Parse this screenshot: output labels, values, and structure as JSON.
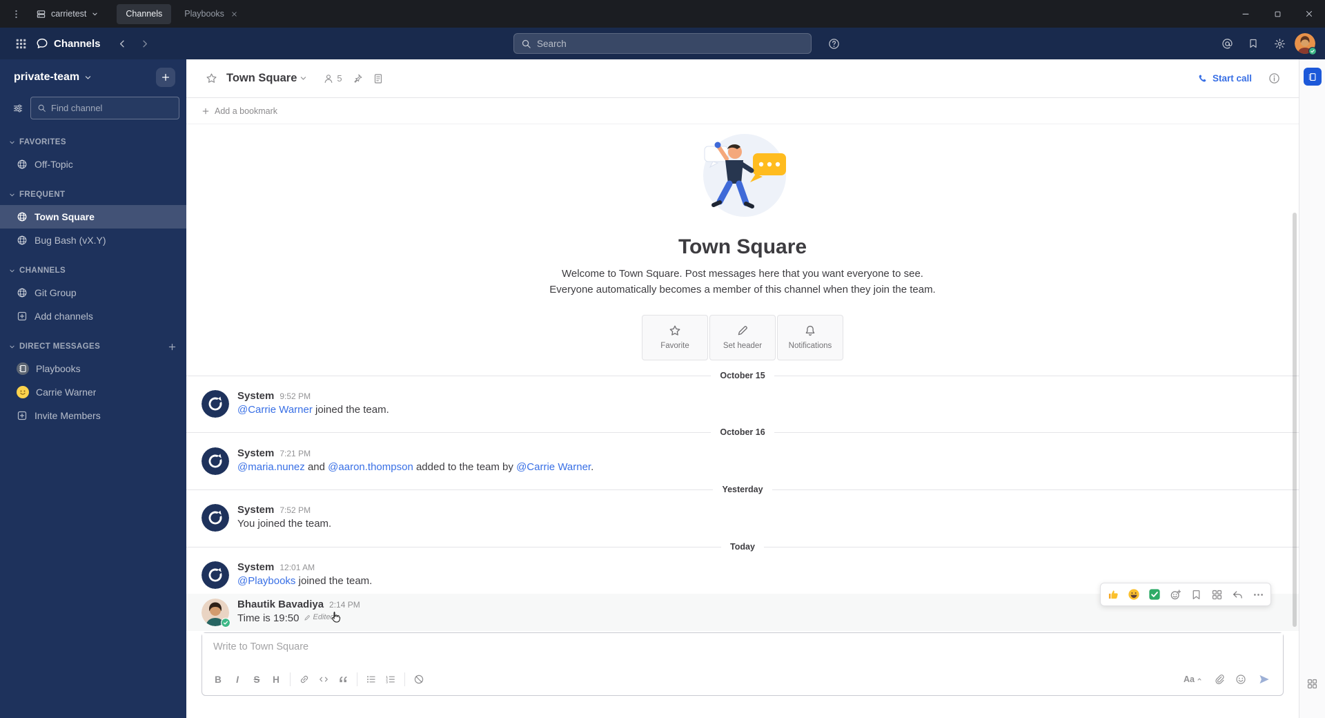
{
  "titlebar": {
    "team_selector": "carrietest",
    "tabs": [
      {
        "label": "Channels",
        "active": true,
        "closable": false
      },
      {
        "label": "Playbooks",
        "active": false,
        "closable": true
      }
    ]
  },
  "global_header": {
    "product_name": "Channels",
    "search_placeholder": "Search"
  },
  "sidebar": {
    "team_name": "private-team",
    "find_channel_placeholder": "Find channel",
    "sections": [
      {
        "label": "FAVORITES",
        "has_add": false,
        "items": [
          {
            "label": "Off-Topic",
            "icon": "globe",
            "active": false
          }
        ]
      },
      {
        "label": "FREQUENT",
        "has_add": false,
        "items": [
          {
            "label": "Town Square",
            "icon": "globe",
            "active": true
          },
          {
            "label": "Bug Bash (vX.Y)",
            "icon": "globe",
            "active": false
          }
        ]
      },
      {
        "label": "CHANNELS",
        "has_add": false,
        "items": [
          {
            "label": "Git Group",
            "icon": "globe",
            "active": false
          },
          {
            "label": "Add channels",
            "icon": "add",
            "active": false
          }
        ]
      },
      {
        "label": "DIRECT MESSAGES",
        "has_add": true,
        "items": [
          {
            "label": "Playbooks",
            "icon": "playbooks-avatar",
            "active": false
          },
          {
            "label": "Carrie Warner",
            "icon": "yellow-avatar",
            "active": false
          },
          {
            "label": "Invite Members",
            "icon": "add",
            "active": false
          }
        ]
      }
    ]
  },
  "channel_header": {
    "title": "Town Square",
    "member_count": "5",
    "start_call_label": "Start call",
    "bookmark_label": "Add a bookmark"
  },
  "intro": {
    "heading": "Town Square",
    "description": "Welcome to Town Square. Post messages here that you want everyone to see. Everyone automatically becomes a member of this channel when they join the team.",
    "actions": [
      {
        "label": "Favorite",
        "icon": "star"
      },
      {
        "label": "Set header",
        "icon": "pencil"
      },
      {
        "label": "Notifications",
        "icon": "bell"
      }
    ]
  },
  "timeline": [
    {
      "type": "divider",
      "label": "October 15"
    },
    {
      "type": "message",
      "sender": "System",
      "avatar": "system-logo",
      "time": "9:52 PM",
      "parts": [
        {
          "text": "@Carrie Warner",
          "link": true
        },
        {
          "text": " joined the team.",
          "link": false
        }
      ]
    },
    {
      "type": "divider",
      "label": "October 16"
    },
    {
      "type": "message",
      "sender": "System",
      "avatar": "system-logo",
      "time": "7:21 PM",
      "parts": [
        {
          "text": "@maria.nunez",
          "link": true
        },
        {
          "text": " and ",
          "link": false
        },
        {
          "text": "@aaron.thompson",
          "link": true
        },
        {
          "text": " added to the team by ",
          "link": false
        },
        {
          "text": "@Carrie Warner",
          "link": true
        },
        {
          "text": ".",
          "link": false
        }
      ]
    },
    {
      "type": "divider",
      "label": "Yesterday"
    },
    {
      "type": "message",
      "sender": "System",
      "avatar": "system-logo",
      "time": "7:52 PM",
      "parts": [
        {
          "text": "You joined the team.",
          "link": false
        }
      ]
    },
    {
      "type": "divider",
      "label": "Today"
    },
    {
      "type": "message",
      "sender": "System",
      "avatar": "system-logo",
      "time": "12:01 AM",
      "parts": [
        {
          "text": "@Playbooks",
          "link": true
        },
        {
          "text": " joined the team.",
          "link": false
        }
      ]
    },
    {
      "type": "message",
      "sender": "Bhautik Bavadiya",
      "avatar": "user-photo",
      "time": "2:14 PM",
      "hovered": true,
      "edited_label": "Edited",
      "parts": [
        {
          "text": "Time is 19:50",
          "link": false
        }
      ]
    }
  ],
  "hover_toolbar": {
    "reactions": [
      "thumbs-up",
      "grinning-face",
      "check-mark-button"
    ],
    "actions": [
      "add-reaction",
      "save-message",
      "message-apps",
      "reply",
      "more-actions"
    ]
  },
  "composer": {
    "placeholder": "Write to Town Square",
    "format_buttons": [
      {
        "name": "bold",
        "glyph": "B"
      },
      {
        "name": "italic",
        "glyph": "I"
      },
      {
        "name": "strikethrough",
        "glyph": "S"
      },
      {
        "name": "heading",
        "glyph": "H"
      },
      {
        "name": "divider"
      },
      {
        "name": "link"
      },
      {
        "name": "code"
      },
      {
        "name": "quote"
      },
      {
        "name": "divider"
      },
      {
        "name": "bulleted-list"
      },
      {
        "name": "numbered-list"
      },
      {
        "name": "divider"
      },
      {
        "name": "slash-commands"
      }
    ],
    "formatting_label": "Aa",
    "right_buttons": [
      "formatting-toggle",
      "attach-file",
      "emoji-picker",
      "send-message"
    ]
  },
  "colors": {
    "accent_blue": "#386fe5",
    "sidebar_bg": "#1e325c",
    "header_bg": "#192a4d",
    "online_green": "#3db887",
    "yellow_bubble": "#ffbc1f"
  }
}
